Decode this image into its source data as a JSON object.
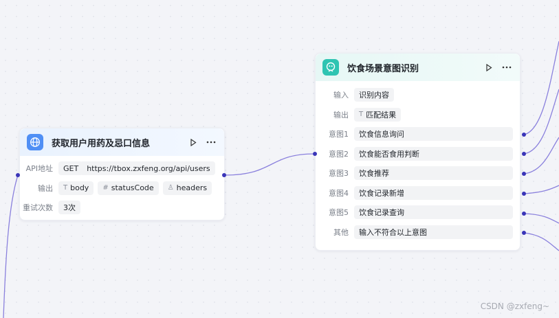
{
  "node1": {
    "title": "获取用户用药及忌口信息",
    "run_icon": "play-icon",
    "more_icon": "more-icon",
    "api_label": "API地址",
    "method": "GET",
    "url": "https://tbox.zxfeng.org/api/users",
    "output_label": "输出",
    "outputs": [
      {
        "glyph": "T",
        "name": "body"
      },
      {
        "glyph": "#",
        "name": "statusCode"
      },
      {
        "glyph": "♙",
        "name": "headers"
      }
    ],
    "retry_label": "重试次数",
    "retry_value": "3次"
  },
  "node2": {
    "title": "饮食场景意图识别",
    "input_label": "输入",
    "input_value": "识别内容",
    "output_label": "输出",
    "output_glyph": "T",
    "output_value": "匹配结果",
    "intents": [
      {
        "label": "意图1",
        "value": "饮食信息询问"
      },
      {
        "label": "意图2",
        "value": "饮食能否食用判断"
      },
      {
        "label": "意图3",
        "value": "饮食推荐"
      },
      {
        "label": "意图4",
        "value": "饮食记录新增"
      },
      {
        "label": "意图5",
        "value": "饮食记录查询"
      },
      {
        "label": "其他",
        "value": "输入不符合以上意图"
      }
    ]
  },
  "watermark": "CSDN @zxfeng~",
  "colors": {
    "edge": "#7c6fd6",
    "port": "#3a35b8",
    "accent_blue": "#4f8ff5",
    "accent_teal": "#2fc4b2"
  }
}
